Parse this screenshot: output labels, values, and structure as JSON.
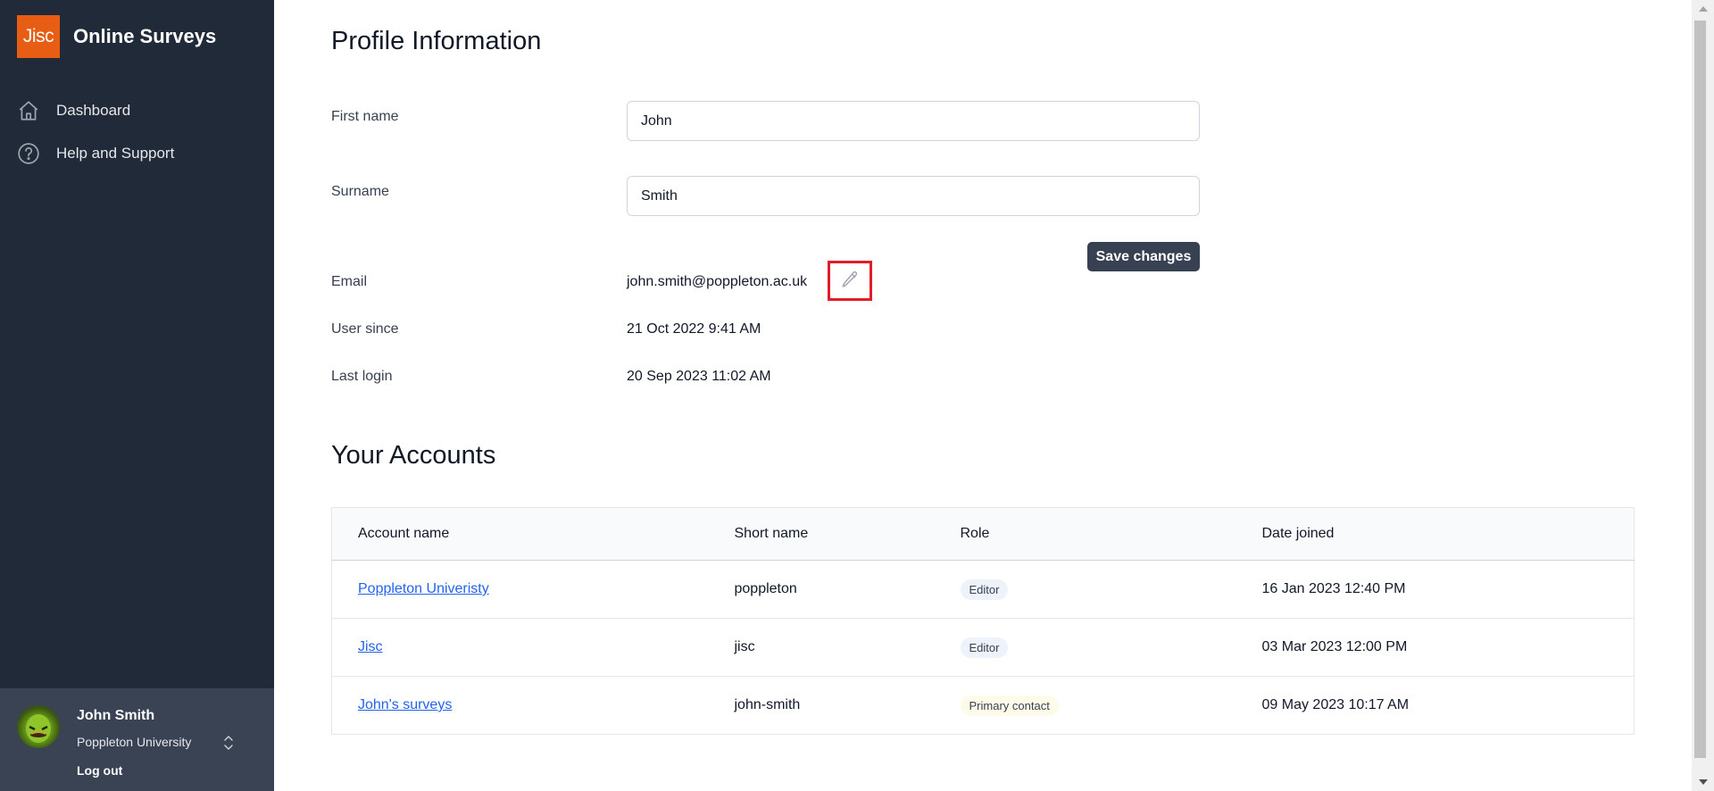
{
  "app": {
    "logo_text": "Jisc",
    "title": "Online Surveys",
    "brand_color": "#e85d14",
    "sidebar_color": "#212a38"
  },
  "sidebar": {
    "items": [
      {
        "label": "Dashboard",
        "icon": "home-icon"
      },
      {
        "label": "Help and Support",
        "icon": "question-circle-icon"
      }
    ]
  },
  "user": {
    "name": "John Smith",
    "organisation": "Poppleton University",
    "logout_label": "Log out",
    "switch_icon": "chevron-up-down-icon"
  },
  "profile": {
    "title": "Profile Information",
    "first_name": {
      "label": "First name",
      "value": "John"
    },
    "surname": {
      "label": "Surname",
      "value": "Smith"
    },
    "save_label": "Save changes",
    "email": {
      "label": "Email",
      "value": "john.smith@poppleton.ac.uk",
      "edit_icon": "pencil-icon"
    },
    "user_since": {
      "label": "User since",
      "value": "21 Oct 2022 9:41 AM"
    },
    "last_login": {
      "label": "Last login",
      "value": "20 Sep 2023 11:02 AM"
    }
  },
  "accounts": {
    "title": "Your Accounts",
    "columns": [
      "Account name",
      "Short name",
      "Role",
      "Date joined"
    ],
    "rows": [
      {
        "name": "Poppleton Univeristy",
        "short": "poppleton",
        "role": "Editor",
        "role_type": "editor",
        "joined": "16 Jan 2023 12:40 PM"
      },
      {
        "name": "Jisc",
        "short": "jisc",
        "role": "Editor",
        "role_type": "editor",
        "joined": "03 Mar 2023 12:00 PM"
      },
      {
        "name": "John's surveys",
        "short": "john-smith",
        "role": "Primary contact",
        "role_type": "primary",
        "joined": "09 May 2023 10:17 AM"
      }
    ]
  },
  "highlight_color": "#e11d2a"
}
